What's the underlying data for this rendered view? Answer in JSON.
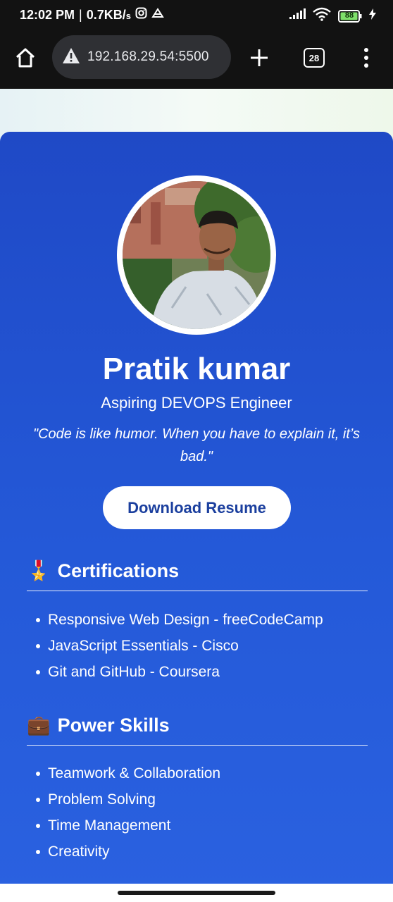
{
  "status_bar": {
    "time": "12:02 PM",
    "speed": "0.7KB/",
    "speed_unit": "s",
    "battery": "88"
  },
  "browser": {
    "url": "192.168.29.54:5500",
    "tab_count": "28"
  },
  "profile": {
    "name": "Pratik kumar",
    "role": "Aspiring DEVOPS Engineer",
    "quote": "\"Code is like humor. When you have to explain it, it’s bad.\"",
    "resume_button": "Download Resume"
  },
  "certifications": {
    "icon": "🎖️",
    "title": "Certifications",
    "items": [
      "Responsive Web Design - freeCodeCamp",
      "JavaScript Essentials - Cisco",
      "Git and GitHub - Coursera"
    ]
  },
  "power_skills": {
    "icon": "💼",
    "title": "Power Skills",
    "items": [
      "Teamwork & Collaboration",
      "Problem Solving",
      "Time Management",
      "Creativity"
    ]
  },
  "colors": {
    "card_top": "#1f49c6",
    "card_bottom": "#2a61e0",
    "button_text": "#1b3f9e",
    "battery_green": "#7ee06a"
  }
}
